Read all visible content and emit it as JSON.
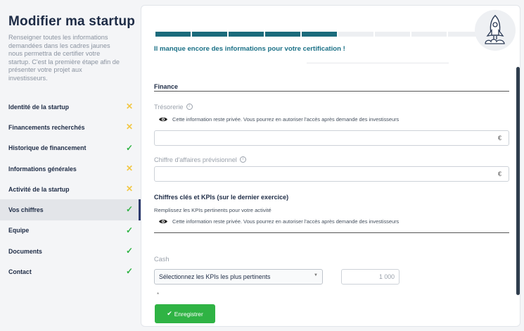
{
  "sidebar": {
    "title": "Modifier ma startup",
    "description": "Renseigner toutes les informations demandées dans les cadres jaunes nous permettra de certifier votre startup. C'est la première étape afin de présenter votre projet aux investisseurs.",
    "items": [
      {
        "label": "Identité de la startup",
        "status": "✕"
      },
      {
        "label": "Financements recherchés",
        "status": "✕"
      },
      {
        "label": "Historique de financement",
        "status": "✓"
      },
      {
        "label": "Informations générales",
        "status": "✕"
      },
      {
        "label": "Activité de la startup",
        "status": "✕"
      },
      {
        "label": "Vos chiffres",
        "status": "✓"
      },
      {
        "label": "Equipe",
        "status": "✓"
      },
      {
        "label": "Documents",
        "status": "✓"
      },
      {
        "label": "Contact",
        "status": "✓"
      }
    ],
    "active_index": 5
  },
  "progress": {
    "completed_segments": 5,
    "total_segments": 9,
    "message": "Il manque encore des informations pour votre certification !"
  },
  "finance": {
    "section_title": "Finance",
    "tresorerie_label": "Trésorerie",
    "privacy_note": "Cette information reste privée. Vous pourrez en autoriser l'accès après demande des investisseurs",
    "currency": "€",
    "ca_label": "Chiffre d'affaires prévisionnel"
  },
  "kpis": {
    "title": "Chiffres clés et KPIs (sur le dernier exercice)",
    "description": "Remplissez les KPIs pertinents pour votre activité",
    "privacy_note": "Cette information reste privée. Vous pourrez en autoriser l'accès après demande des investisseurs",
    "cash_label": "Cash",
    "select_value": "Sélectionnez les KPIs les plus pertinents",
    "kpi_placeholder": "1 000",
    "required_mark": "*"
  },
  "actions": {
    "save_label": "Enregistrer"
  },
  "colors": {
    "accent": "#1b6b7c",
    "success": "#2fb344",
    "warning": "#f2c744"
  }
}
